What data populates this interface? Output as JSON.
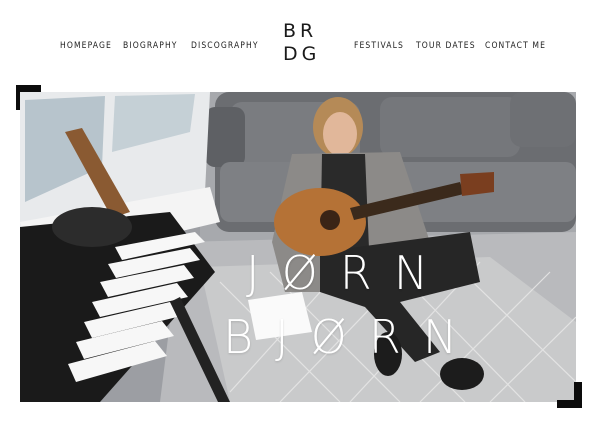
{
  "nav": {
    "left": [
      "HOMEPAGE",
      "BIOGRAPHY",
      "DISCOGRAPHY"
    ],
    "right": [
      "FESTIVALS",
      "TOUR DATES",
      "CONTACT ME"
    ]
  },
  "logo": {
    "line1": "BR",
    "line2": "DG"
  },
  "hero": {
    "title_line1": "JØRN",
    "title_line2": "BJØRN"
  },
  "colors": {
    "text": "#222222",
    "hero_title": "#ffffff",
    "accent_corners": "#0c0c0c"
  }
}
